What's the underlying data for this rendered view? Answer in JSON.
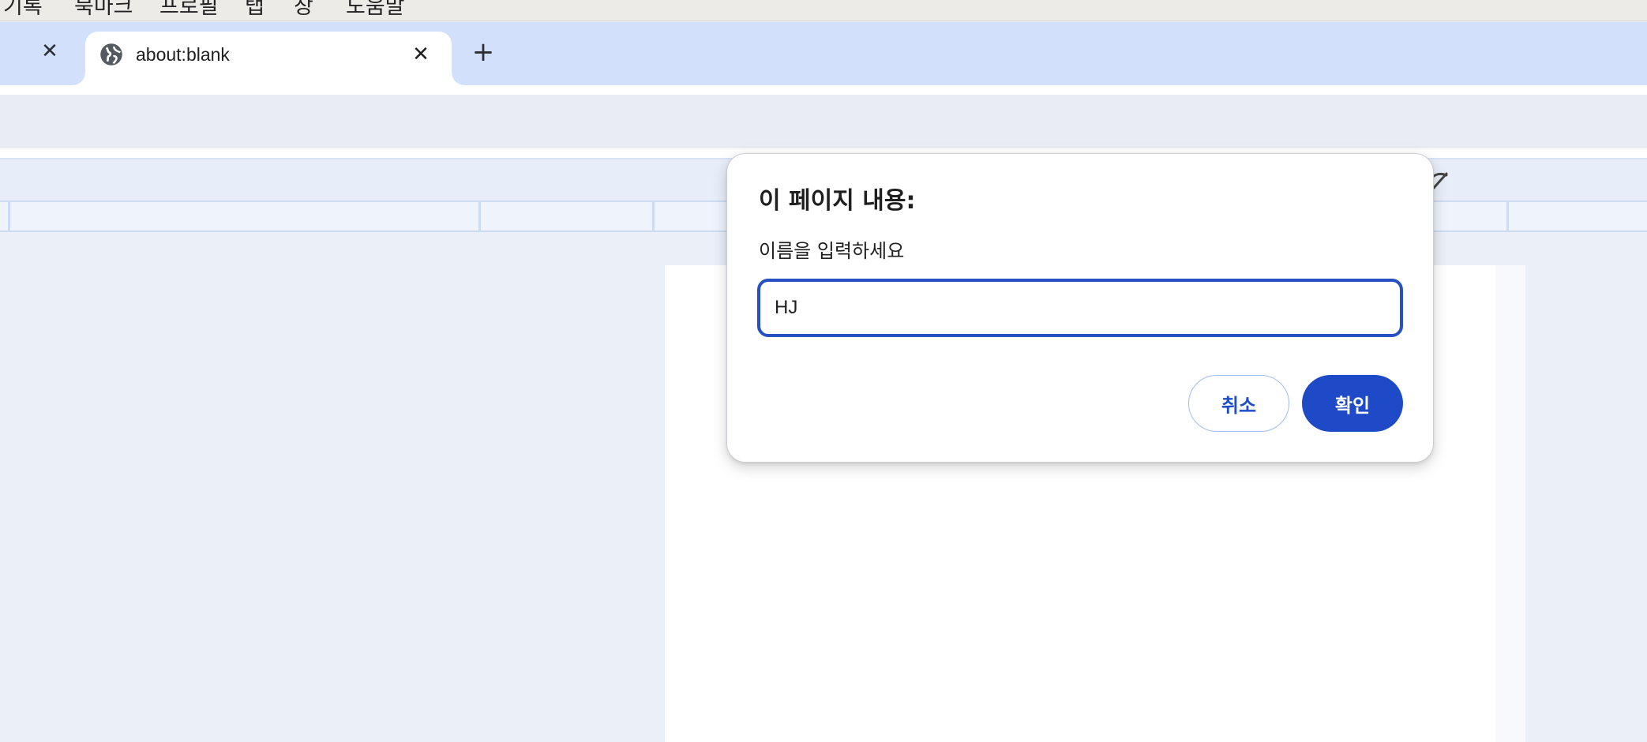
{
  "menubar": {
    "items": [
      "기록",
      "북마크",
      "프로필",
      "탭",
      "창",
      "도움말"
    ]
  },
  "tabs": {
    "active_title": "about:blank",
    "prev_close_icon": "close-icon",
    "close_icon": "close-icon",
    "new_tab_icon": "plus-icon",
    "favicon": "globe-icon"
  },
  "dialog": {
    "title": "이 페이지 내용:",
    "message": "이름을 입력하세요",
    "input_value": "HJ",
    "cancel_label": "취소",
    "ok_label": "확인"
  },
  "colors": {
    "tabstrip": "#d3e0fb",
    "accent": "#1f4ac7",
    "input_border": "#2650c4"
  }
}
